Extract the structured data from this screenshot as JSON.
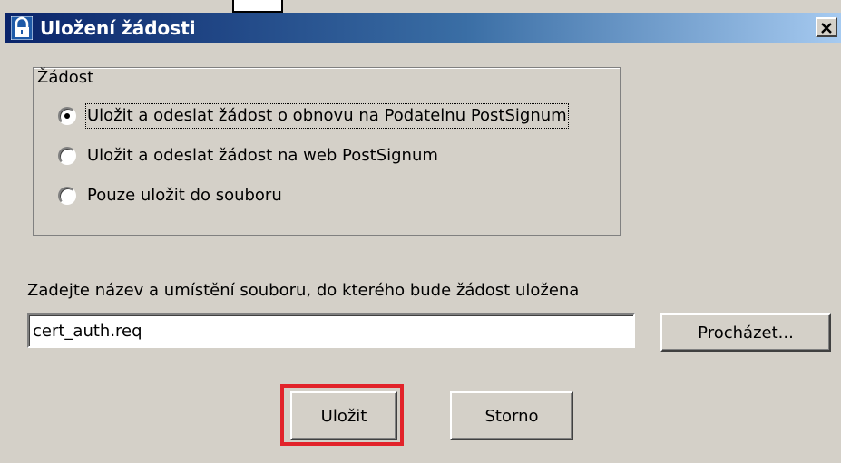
{
  "window": {
    "title": "Uložení žádosti"
  },
  "group": {
    "legend": "Žádost",
    "options": [
      {
        "label": "Uložit a odeslat žádost o obnovu na Podatelnu PostSignum",
        "checked": true
      },
      {
        "label": "Uložit a odeslat žádost na web PostSignum",
        "checked": false
      },
      {
        "label": "Pouze uložit do souboru",
        "checked": false
      }
    ]
  },
  "file": {
    "instruction": "Zadejte název a umístění souboru, do kterého bude žádost uložena",
    "value": "cert_auth.req",
    "browse_label": "Procházet..."
  },
  "actions": {
    "save_label": "Uložit",
    "cancel_label": "Storno"
  },
  "icons": {
    "app": "lock-icon",
    "close": "close-icon"
  },
  "colors": {
    "highlight": "#e2232a",
    "title_start": "#0a246a",
    "title_end": "#a6caf0",
    "face": "#d4d0c8"
  }
}
